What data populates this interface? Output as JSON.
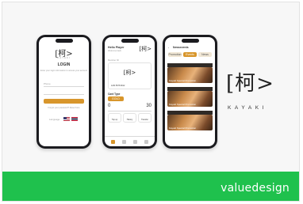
{
  "login_screen": {
    "logo_kanji": "[柯>",
    "brand": "KAYAKI",
    "title": "LOGIN",
    "subtitle": "Enter your login information to access your account",
    "username_placeholder": "Phone",
    "password_placeholder": "Password",
    "login_button": "LOGIN",
    "forgot": "Forgot your password? Reset here",
    "language_label": "Language"
  },
  "card_screen": {
    "greeting": "Hello Player",
    "sub": "Welcome back",
    "logo_kanji": "[柯>",
    "member_label": "Member ID",
    "card_logo": "[柯>",
    "card_number": "1234 5678 9012",
    "card_type_label": "Card Type",
    "card_type_value": "GOLD",
    "card_value": "30",
    "points_value": "0",
    "actions": [
      "Top up",
      "History",
      "Transfer"
    ],
    "nav": [
      "Home",
      "Card",
      "News",
      "Profile"
    ]
  },
  "news_screen": {
    "title": "Newsevents",
    "tabs": [
      "Promotion",
      "Events",
      "News"
    ],
    "items": [
      "Kayaki Special Promotion",
      "Kayaki Special Promotion",
      "Kayaki Special Promotion"
    ]
  },
  "brand": {
    "kanji": "[柯>",
    "name": "KAYAKI"
  },
  "banner": {
    "text": "valuedesign",
    "color": "#1fc14d"
  },
  "colors": {
    "accent": "#d8962c",
    "phone_frame": "#1b1b1f"
  }
}
